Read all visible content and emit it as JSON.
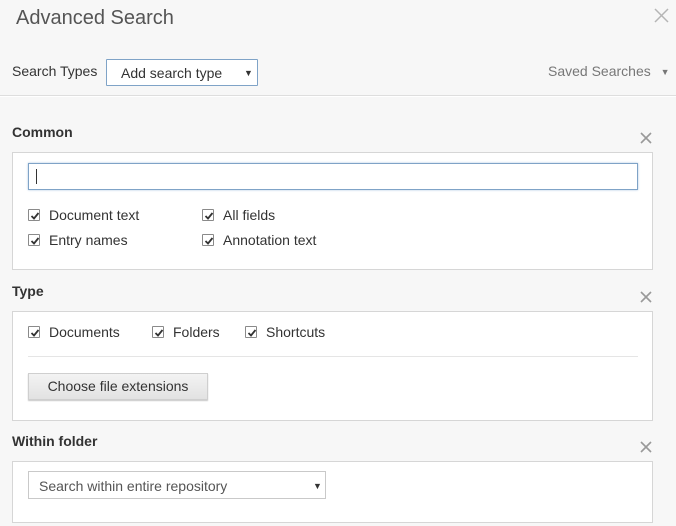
{
  "dialog": {
    "title": "Advanced Search"
  },
  "toolbar": {
    "search_types_label": "Search Types",
    "search_type_select": "Add search type",
    "saved_searches": "Saved Searches"
  },
  "sections": {
    "common": {
      "title": "Common",
      "query_value": "",
      "options": [
        {
          "label": "Document text",
          "checked": true
        },
        {
          "label": "All fields",
          "checked": true
        },
        {
          "label": "Entry names",
          "checked": true
        },
        {
          "label": "Annotation text",
          "checked": true
        }
      ]
    },
    "type": {
      "title": "Type",
      "options": [
        {
          "label": "Documents",
          "checked": true
        },
        {
          "label": "Folders",
          "checked": true
        },
        {
          "label": "Shortcuts",
          "checked": true
        }
      ],
      "extensions_button": "Choose file extensions"
    },
    "within_folder": {
      "title": "Within folder",
      "select_value": "Search within entire repository"
    }
  },
  "icons": {
    "close": "close-icon",
    "remove": "remove-section-icon",
    "caret": "caret-down-icon",
    "checkmark": "checkmark-icon"
  }
}
